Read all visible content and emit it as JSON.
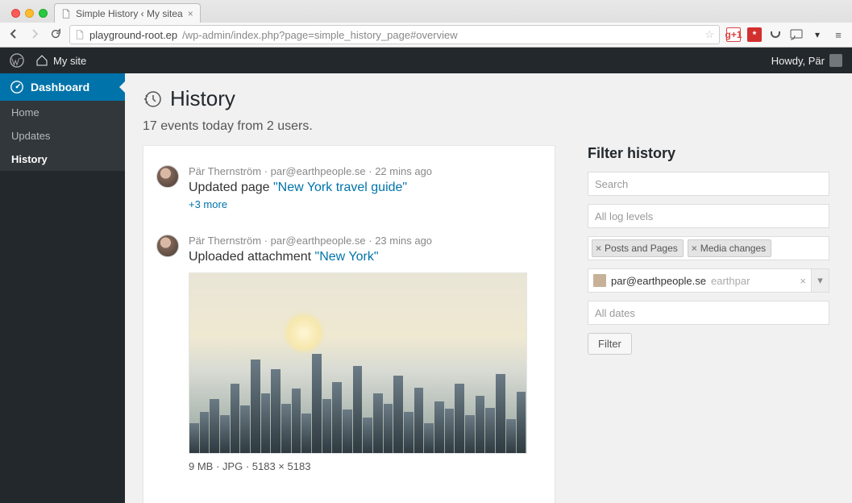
{
  "browser": {
    "tab_title": "Simple History ‹ My sitea",
    "url_host": "playground-root.ep",
    "url_path": "/wp-admin/index.php?page=simple_history_page#overview"
  },
  "wpbar": {
    "site_name": "My site",
    "howdy": "Howdy, Pär"
  },
  "sidebar": {
    "dashboard_label": "Dashboard",
    "items": [
      {
        "label": "Home"
      },
      {
        "label": "Updates"
      },
      {
        "label": "History"
      }
    ]
  },
  "page": {
    "title": "History",
    "summary": "17 events today from 2 users."
  },
  "events": [
    {
      "author": "Pär Thernström",
      "email": "par@earthpeople.se",
      "time": "22 mins ago",
      "action_prefix": "Updated page ",
      "link_text": "\"New York travel guide\"",
      "more": "+3 more"
    },
    {
      "author": "Pär Thernström",
      "email": "par@earthpeople.se",
      "time": "23 mins ago",
      "action_prefix": "Uploaded attachment ",
      "link_text": "\"New York\"",
      "attachment": {
        "size": "9 MB",
        "format": "JPG",
        "dimensions": "5183 × 5183"
      }
    }
  ],
  "filter": {
    "title": "Filter history",
    "search_placeholder": "Search",
    "levels_placeholder": "All log levels",
    "chips": [
      "Posts and Pages",
      "Media changes"
    ],
    "user_email": "par@earthpeople.se",
    "user_typed": "earthpar",
    "dates_placeholder": "All dates",
    "button": "Filter"
  }
}
